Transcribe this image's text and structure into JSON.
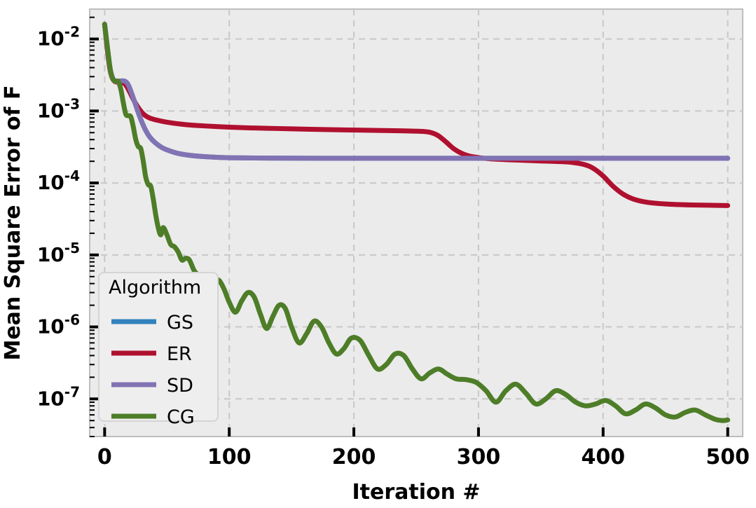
{
  "chart_data": {
    "type": "line",
    "title": "",
    "xlabel": "Iteration #",
    "ylabel": "Mean Square Error of F",
    "xlim": [
      -12,
      512
    ],
    "ylim": [
      3e-08,
      0.026
    ],
    "yscale": "log",
    "xscale": "linear",
    "grid": true,
    "grid_style": "dashed",
    "xticks": [
      0,
      100,
      200,
      300,
      400,
      500
    ],
    "xticklabels": [
      "0",
      "100",
      "200",
      "300",
      "400",
      "500"
    ],
    "yticks": [
      0.01,
      0.001,
      0.0001,
      1e-05,
      1e-06,
      1e-07
    ],
    "yticklabels": [
      "10-2",
      "10-3",
      "10-4",
      "10-5",
      "10-6",
      "10-7"
    ],
    "ytick_mantissa": "10",
    "ytick_exponents": [
      "-2",
      "-3",
      "-4",
      "-5",
      "-6",
      "-7"
    ],
    "legend": {
      "title": "Algorithm",
      "position": "lower left",
      "entries": [
        "GS",
        "ER",
        "SD",
        "CG"
      ]
    },
    "colors": {
      "GS": "#3182bd",
      "ER": "#b0102f",
      "SD": "#8173b3",
      "CG": "#4e7d28",
      "background": "#ebebeb",
      "grid": "#c8c8c8",
      "axis": "#bdbdbd",
      "text": "#000000",
      "legend_background": "#eeeeee",
      "legend_border": "#d0d0d0"
    },
    "series": [
      {
        "name": "GS",
        "note": "overlaps exactly with SD and is hidden beneath it",
        "x": [
          0,
          2,
          4,
          6,
          8,
          10,
          12,
          14,
          16,
          18,
          20,
          24,
          28,
          32,
          36,
          40,
          46,
          52,
          60,
          70,
          80,
          90,
          100,
          120,
          150,
          200,
          250,
          300,
          350,
          400,
          450,
          500
        ],
        "y": [
          0.016,
          0.008,
          0.0042,
          0.003,
          0.00262,
          0.00258,
          0.0026,
          0.00262,
          0.0026,
          0.00245,
          0.0021,
          0.00135,
          0.00085,
          0.00058,
          0.00044,
          0.00037,
          0.00031,
          0.00028,
          0.000255,
          0.00024,
          0.000232,
          0.000227,
          0.000224,
          0.000222,
          0.000221,
          0.00022,
          0.00022,
          0.00022,
          0.00022,
          0.00022,
          0.00022,
          0.00022
        ]
      },
      {
        "name": "ER",
        "x": [
          0,
          2,
          4,
          6,
          8,
          10,
          12,
          14,
          16,
          18,
          20,
          24,
          28,
          32,
          36,
          40,
          46,
          52,
          60,
          70,
          80,
          100,
          120,
          150,
          180,
          210,
          240,
          255,
          262,
          268,
          274,
          280,
          286,
          292,
          300,
          310,
          330,
          350,
          365,
          375,
          385,
          392,
          400,
          408,
          416,
          424,
          435,
          450,
          470,
          500
        ],
        "y": [
          0.016,
          0.0075,
          0.004,
          0.0029,
          0.00258,
          0.00252,
          0.00252,
          0.0025,
          0.0024,
          0.00215,
          0.00185,
          0.00135,
          0.00105,
          0.00088,
          0.0008,
          0.00076,
          0.00072,
          0.00069,
          0.00066,
          0.000635,
          0.00062,
          0.000595,
          0.00058,
          0.000565,
          0.00055,
          0.00054,
          0.00053,
          0.00052,
          0.0005,
          0.00045,
          0.00037,
          0.0003,
          0.00026,
          0.000238,
          0.000225,
          0.000216,
          0.000208,
          0.000202,
          0.000198,
          0.000193,
          0.00018,
          0.00016,
          0.000125,
          9e-05,
          7e-05,
          6e-05,
          5.4e-05,
          5.1e-05,
          4.95e-05,
          4.85e-05
        ]
      },
      {
        "name": "SD",
        "x": [
          0,
          2,
          4,
          6,
          8,
          10,
          12,
          14,
          16,
          18,
          20,
          24,
          28,
          32,
          36,
          40,
          46,
          52,
          60,
          70,
          80,
          90,
          100,
          120,
          150,
          200,
          250,
          300,
          350,
          400,
          450,
          500
        ],
        "y": [
          0.016,
          0.008,
          0.0042,
          0.003,
          0.00262,
          0.00258,
          0.0026,
          0.00262,
          0.0026,
          0.00245,
          0.0021,
          0.00135,
          0.00085,
          0.00058,
          0.00044,
          0.00037,
          0.00031,
          0.00028,
          0.000255,
          0.00024,
          0.000232,
          0.000227,
          0.000224,
          0.000222,
          0.000221,
          0.00022,
          0.00022,
          0.00022,
          0.00022,
          0.00022,
          0.00022,
          0.00022
        ]
      },
      {
        "name": "CG",
        "x": [
          0,
          3,
          5,
          7,
          9,
          11,
          13,
          15,
          17,
          19,
          21,
          23,
          25,
          27,
          29,
          31,
          33,
          35,
          37,
          39,
          41,
          43,
          45,
          47,
          50,
          53,
          56,
          59,
          62,
          65,
          68,
          72,
          76,
          80,
          84,
          88,
          92,
          96,
          100,
          105,
          110,
          115,
          120,
          125,
          130,
          135,
          140,
          145,
          150,
          156,
          162,
          168,
          174,
          180,
          186,
          192,
          198,
          205,
          212,
          219,
          226,
          233,
          240,
          247,
          254,
          261,
          268,
          275,
          282,
          290,
          298,
          306,
          314,
          322,
          330,
          338,
          346,
          354,
          362,
          370,
          378,
          386,
          394,
          402,
          410,
          418,
          426,
          434,
          442,
          450,
          458,
          466,
          474,
          482,
          490,
          496,
          500
        ],
        "y": [
          0.016,
          0.006,
          0.0034,
          0.0027,
          0.0026,
          0.00255,
          0.002,
          0.0013,
          0.0009,
          0.00086,
          0.00083,
          0.0006,
          0.0004,
          0.00032,
          0.0003,
          0.0002,
          0.00012,
          9.5e-05,
          9e-05,
          6e-05,
          3.6e-05,
          2.4e-05,
          1.9e-05,
          2.4e-05,
          1.9e-05,
          1.4e-05,
          1.3e-05,
          1.1e-05,
          8.5e-06,
          9e-06,
          8.5e-06,
          6e-06,
          5.2e-06,
          4.9e-06,
          4.8e-06,
          4.6e-06,
          4.4e-06,
          3.3e-06,
          2.2e-06,
          1.6e-06,
          2.3e-06,
          3e-06,
          2.6e-06,
          1.5e-06,
          9.5e-07,
          1.4e-06,
          2e-06,
          1.8e-06,
          1e-06,
          6e-07,
          8e-07,
          1.2e-06,
          1e-06,
          6e-07,
          4.2e-07,
          5e-07,
          7e-07,
          6.5e-07,
          4e-07,
          2.6e-07,
          3e-07,
          4.2e-07,
          4e-07,
          2.6e-07,
          1.9e-07,
          2.3e-07,
          2.6e-07,
          2.2e-07,
          1.9e-07,
          1.85e-07,
          1.7e-07,
          1.3e-07,
          9e-08,
          1.3e-07,
          1.6e-07,
          1.2e-07,
          8.5e-08,
          1e-07,
          1.3e-07,
          1.15e-07,
          9e-08,
          8e-08,
          8.5e-08,
          9.5e-08,
          8e-08,
          6.2e-08,
          7e-08,
          8.5e-08,
          7.5e-08,
          6e-08,
          5.6e-08,
          6.5e-08,
          7e-08,
          6e-08,
          5.2e-08,
          5e-08,
          5.1e-08
        ]
      }
    ]
  }
}
